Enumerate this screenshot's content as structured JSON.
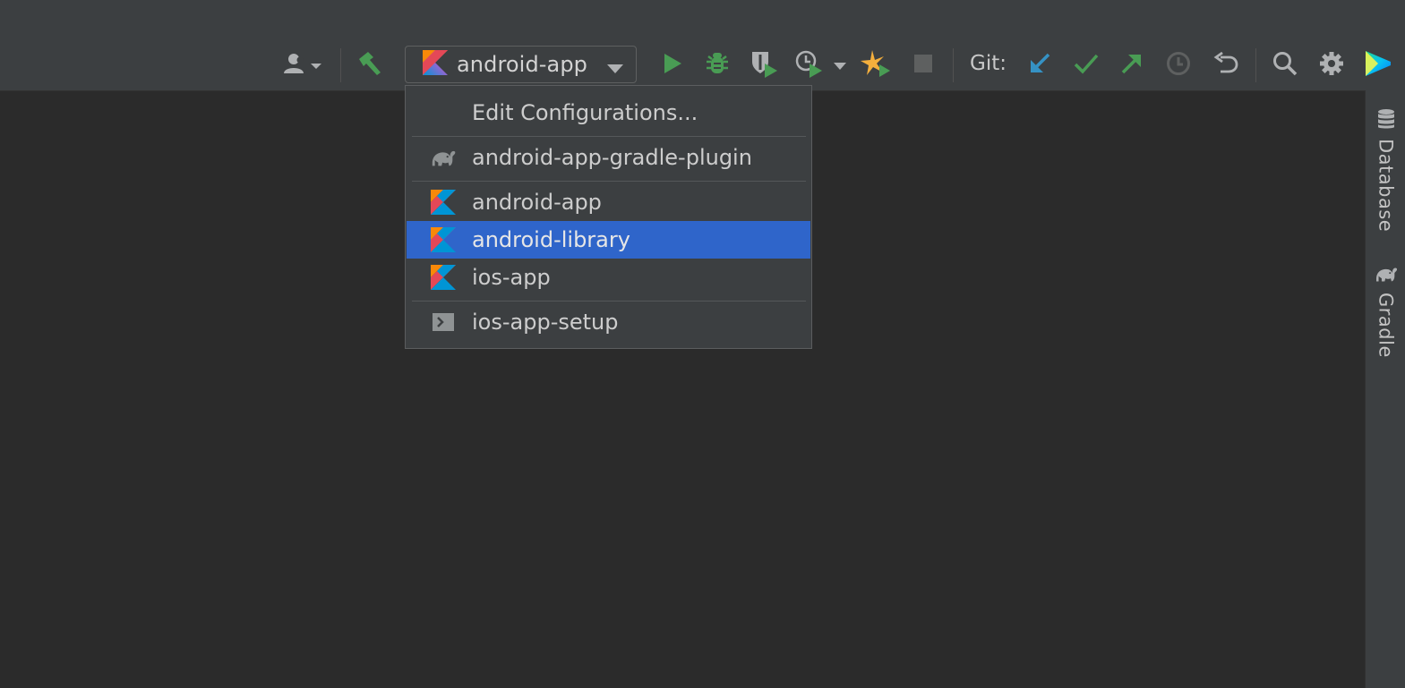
{
  "toolbar": {
    "run_config": {
      "selected": "android-app",
      "icon": "kotlin-icon"
    },
    "git_label": "Git:",
    "icons": [
      "user-icon",
      "hammer-icon",
      "run-icon",
      "debug-icon",
      "coverage-icon",
      "profile-icon",
      "attach-icon",
      "stop-icon",
      "git-update-icon",
      "git-commit-icon",
      "git-push-icon",
      "history-icon",
      "rollback-icon",
      "search-icon",
      "gear-icon",
      "toolbox-icon"
    ]
  },
  "dropdown": {
    "edit_item": "Edit Configurations...",
    "items": [
      {
        "label": "android-app-gradle-plugin",
        "icon": "gradle-elephant-icon"
      },
      {
        "label": "android-app",
        "icon": "kotlin-icon"
      },
      {
        "label": "android-library",
        "icon": "kotlin-icon",
        "selected": true
      },
      {
        "label": "ios-app",
        "icon": "kotlin-icon"
      },
      {
        "label": "ios-app-setup",
        "icon": "shell-script-icon"
      }
    ]
  },
  "right_strip": {
    "database": "Database",
    "gradle": "Gradle"
  },
  "colors": {
    "toolbar_bg": "#3c3f41",
    "editor_bg": "#2b2b2b",
    "selection": "#2f65ca",
    "run_green": "#499c54",
    "vcs_blue": "#3592c4",
    "attach_orange": "#f4af3d"
  }
}
